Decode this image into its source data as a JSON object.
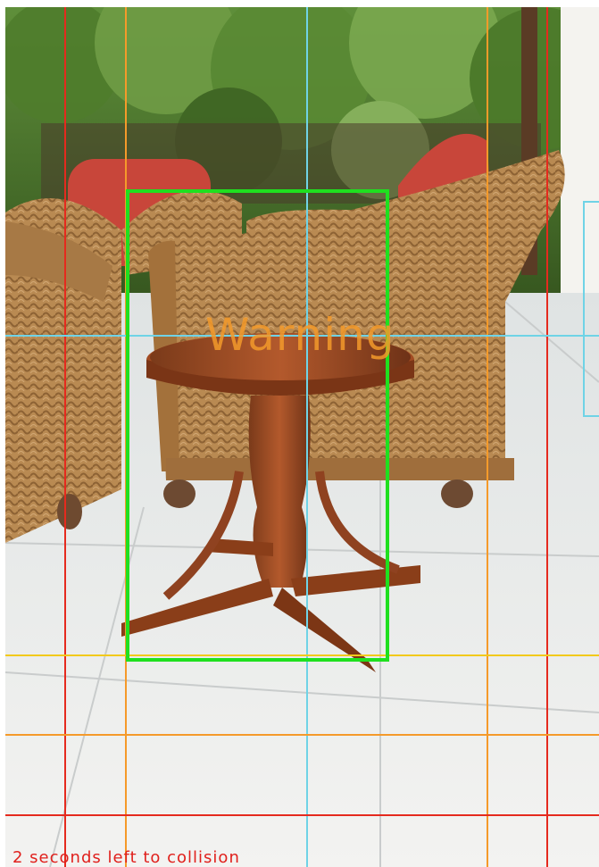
{
  "hud": {
    "warning_text": "Warning",
    "countdown_text": "2 seconds left to collision"
  },
  "colors": {
    "warning": "#f39a2b",
    "countdown": "#e0201c",
    "detection_box": "#1fe01f",
    "grid_red": "#e52a1e",
    "grid_orange": "#f59a2a",
    "grid_cyan": "#6fd3e6",
    "grid_yellow": "#f2c91b"
  },
  "scene": {
    "description_icon": "photo-scene-icon"
  }
}
